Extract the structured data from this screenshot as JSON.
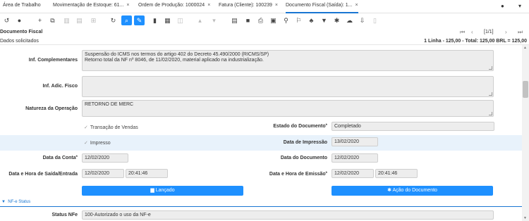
{
  "tabs": {
    "t1": "Área de Trabalho",
    "t2": "Movimentação de Estoque: 61...",
    "t3": "Ordem de Produção: 1000024",
    "t4": "Fatura (Cliente): 100239",
    "t5": "Documento Fiscal (Saída): 1...",
    "close": "×"
  },
  "window": {
    "title": "Documento Fiscal",
    "pager": "[1/1]"
  },
  "status": {
    "left": "Dados solicitados",
    "right": "1 Linha - 125,00 - Total: 125,00 BRL = 125,00"
  },
  "form": {
    "inf_complementares_label": "Inf. Complementares",
    "inf_complementares_line1": "Suspensão do ICMS nos termos do artigo 402 do Decreto 45.490/2000 (RICMS/SP)",
    "inf_complementares_line2": "Retorno total da NF nº 8046, de 11/02/2020, material aplicado na industrialização.",
    "inf_adic_fisco_label": "Inf. Adic. Fisco",
    "inf_adic_fisco_value": "",
    "natureza_label": "Natureza da Operação",
    "natureza_value": "RETORNO DE MERC",
    "transacao_label": "Transação de Vendas",
    "estado_label": "Estado do Documento",
    "estado_value": "Completado",
    "impresso_label": "Impresso",
    "data_impressao_label": "Data de Impressão",
    "data_impressao_value": "13/02/2020",
    "data_conta_label": "Data da Conta",
    "data_conta_value": "12/02/2020",
    "data_documento_label": "Data do Documento",
    "data_documento_value": "12/02/2020",
    "saida_label": "Data e Hora de Saída/Entrada",
    "saida_date": "12/02/2020",
    "saida_time": "20:41:46",
    "emissao_label": "Data e Hora de Emissão",
    "emissao_date": "12/02/2020",
    "emissao_time": "20:41:46",
    "lancado_label": "Lançado",
    "acao_label": "Ação do Documento",
    "nfe_section": "NF-e Status",
    "status_nfe_label": "Status NFe",
    "status_nfe_value": "100-Autorizado o uso da NF-e"
  },
  "colors": {
    "accent": "#1e90ff",
    "highlight_row": "#e8f2fb",
    "field_bg": "#ededed"
  }
}
